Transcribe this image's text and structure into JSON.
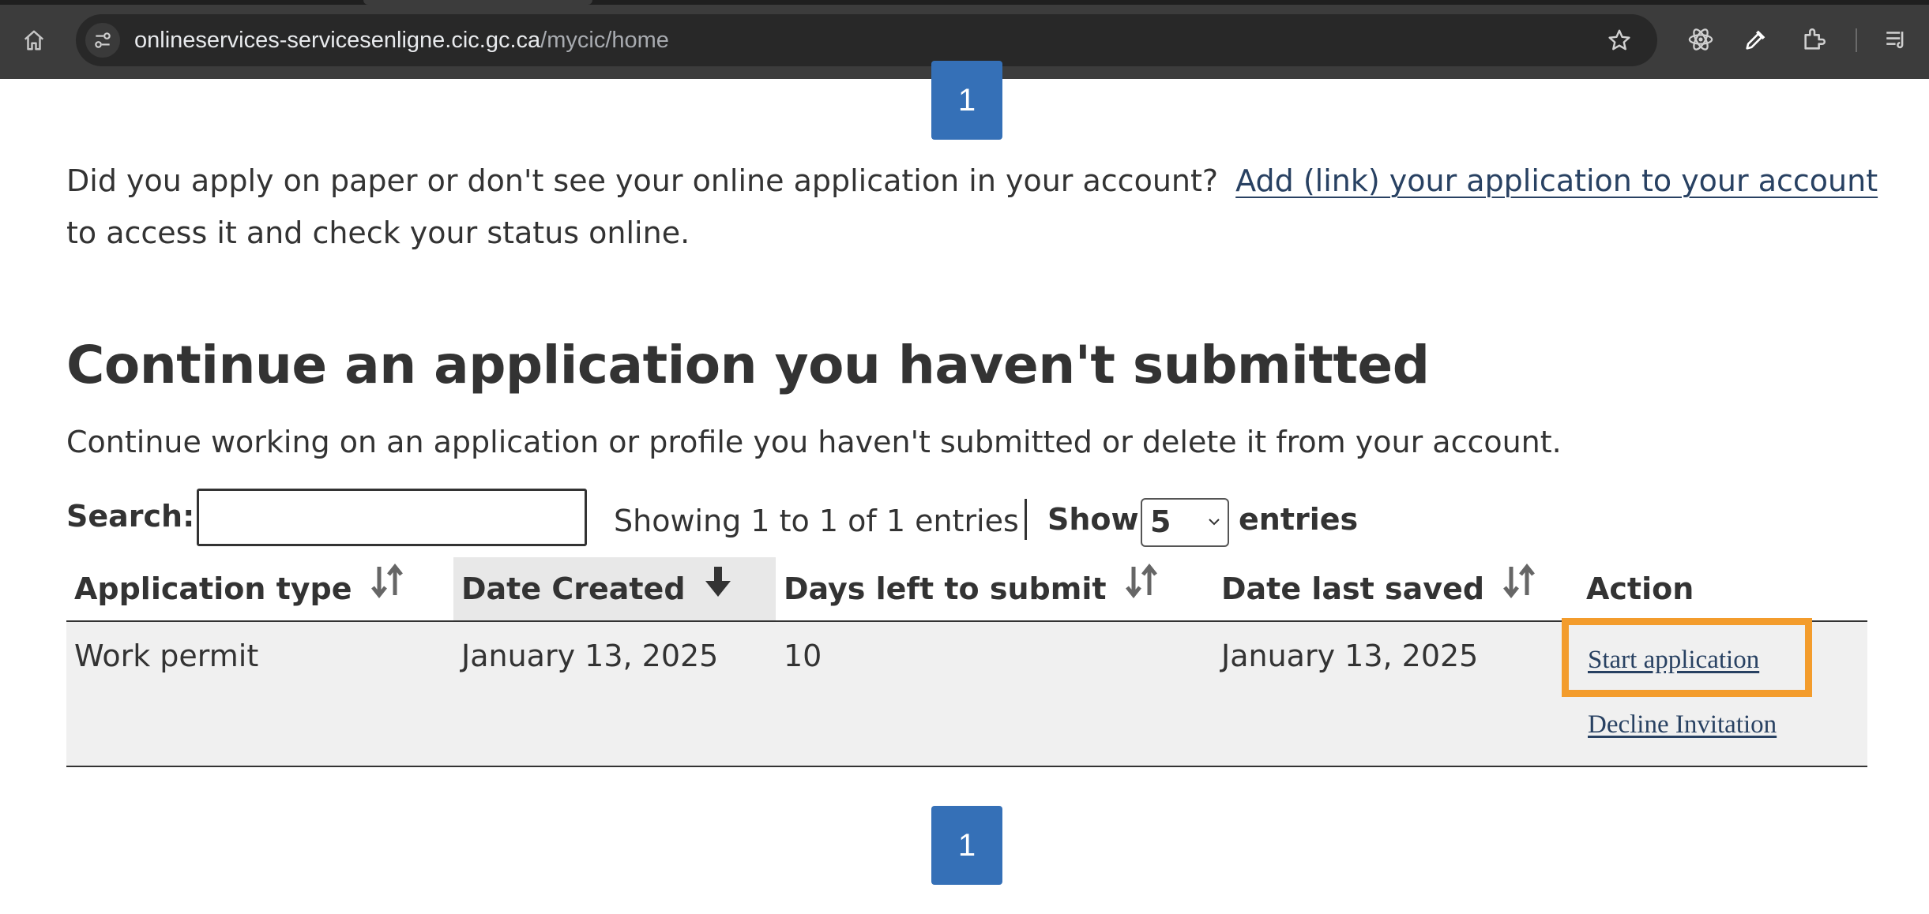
{
  "browser": {
    "url_host": "onlineservices-servicesenligne.cic.gc.ca",
    "url_path": "/mycic/home",
    "icons": [
      "home-icon",
      "site-info-icon",
      "star-icon",
      "react-devtools-icon",
      "eyedropper-icon",
      "extensions-icon",
      "reading-list-icon"
    ]
  },
  "pagination": {
    "page": "1"
  },
  "intro": {
    "text": "Did you apply on paper or don't see your online application in your account?",
    "link": "Add (link) your application to your account",
    "suffix": "to access it and check your status online."
  },
  "section": {
    "heading": "Continue an application you haven't submitted",
    "description": "Continue working on an application or profile you haven't submitted or delete it from your account."
  },
  "controls": {
    "search_label": "Search:",
    "search_value": "",
    "showing": "Showing 1 to 1 of 1 entries",
    "show_label": "Show",
    "page_size": "5",
    "entries_label": "entries"
  },
  "table": {
    "headers": [
      "Application type",
      "Date Created",
      "Days left to submit",
      "Date last saved",
      "Action"
    ],
    "rows": [
      {
        "application_type": "Work permit",
        "date_created": "January 13, 2025",
        "days_left": "10",
        "date_last_saved": "January 13, 2025",
        "actions": [
          "Start application",
          "Decline Invitation"
        ]
      }
    ]
  },
  "colors": {
    "accent": "#3570b7",
    "link": "#284162",
    "highlight": "#f39c2c",
    "row_bg": "#f0f0f0"
  }
}
